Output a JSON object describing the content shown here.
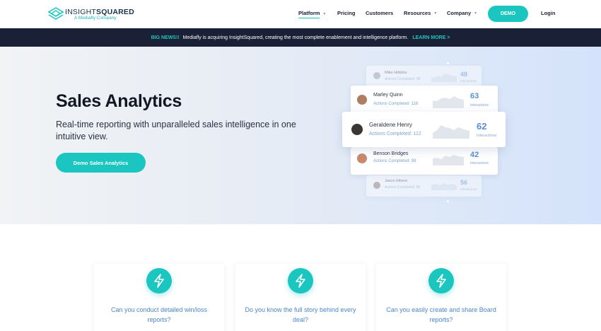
{
  "header": {
    "logo_light": "INSIGHT",
    "logo_bold": "SQUARED",
    "logo_sub": "A Mediafly Company",
    "nav": [
      {
        "label": "Platform",
        "caret": "▼"
      },
      {
        "label": "Pricing"
      },
      {
        "label": "Customers"
      },
      {
        "label": "Resources",
        "caret": "▼"
      },
      {
        "label": "Company",
        "caret": "▼"
      }
    ],
    "demo_label": "DEMO",
    "login_label": "Login"
  },
  "announcement": {
    "big": "BIG NEWS!!",
    "message": "Mediafly is acquiring InsightSquared, creating the most complete enablement and intelligence platform.",
    "more": "LEARN MORE >"
  },
  "hero": {
    "title": "Sales Analytics",
    "description": "Real-time reporting with unparalleled sales intelligence in one intuitive view.",
    "button": "Demo Sales Analytics",
    "cards": [
      {
        "name": "Mike Hibbins",
        "actions": "Actions Completed: 98",
        "value": "48",
        "unit": "Interactions"
      },
      {
        "name": "Marley Quinn",
        "actions": "Actions Completed: 116",
        "value": "63",
        "unit": "Interactions"
      },
      {
        "name": "Geraldene Henry",
        "actions": "Actions Completed: 112",
        "value": "62",
        "unit": "Interactions"
      },
      {
        "name": "Benson Bridges",
        "actions": "Actions Completed: 98",
        "value": "42",
        "unit": "Interactions"
      },
      {
        "name": "Jason Ellison",
        "actions": "Actions Completed: 85",
        "value": "56",
        "unit": "Interactions"
      }
    ]
  },
  "features": [
    {
      "text": "Can you conduct detailed win/loss reports?",
      "icon": "lightning-icon"
    },
    {
      "text": "Do you know the full story behind every deal?",
      "icon": "lightning-icon"
    },
    {
      "text": "Can you easily create and share Board reports?",
      "icon": "lightning-icon"
    }
  ],
  "colors": {
    "accent": "#1cc6c0",
    "dark_bar": "#1a2036",
    "link_blue": "#4a86d0"
  }
}
